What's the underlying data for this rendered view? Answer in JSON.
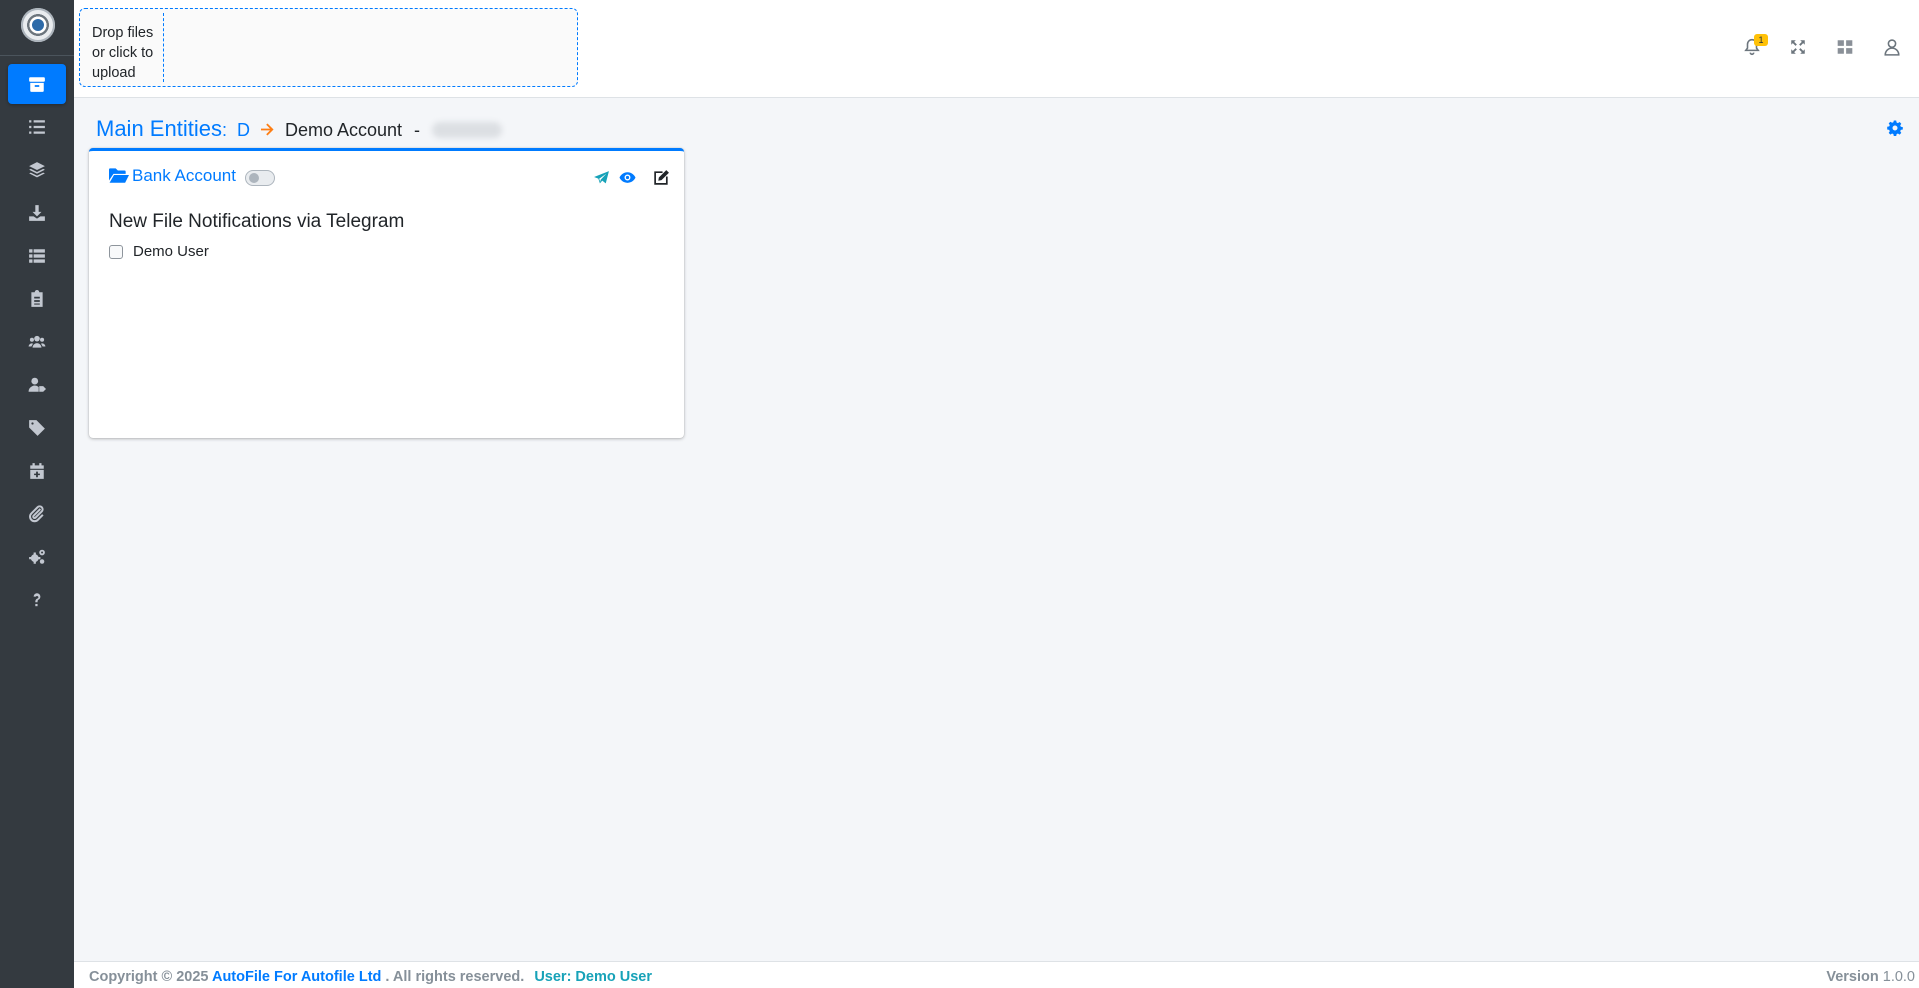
{
  "upload": {
    "dropzone_text": "Drop files or click to upload"
  },
  "topbar": {
    "notification_count": "1"
  },
  "breadcrumb": {
    "main": "Main Entities",
    "colon": ":",
    "level1": "D",
    "level2": "Demo Account",
    "separator": "-"
  },
  "card": {
    "title": "Bank Account",
    "toggle_on": false,
    "section_title": "New File Notifications via Telegram",
    "users": [
      {
        "label": "Demo User",
        "checked": false
      }
    ]
  },
  "footer": {
    "copyright": "Copyright © 2025",
    "company": "AutoFile For Autofile Ltd",
    "rights": ". All rights reserved.",
    "user": "User: Demo User",
    "version_label": "Version",
    "version_value": "1.0.0"
  },
  "colors": {
    "accent": "#007bff",
    "sidebar_bg": "#343a40",
    "badge": "#ffc107",
    "telegram": "#17a2b8",
    "arrow": "#fd7e14"
  },
  "sidebar": {
    "items": [
      {
        "icon": "archive-icon",
        "active": true
      },
      {
        "icon": "list-icon"
      },
      {
        "icon": "layers-icon"
      },
      {
        "icon": "download-icon"
      },
      {
        "icon": "table-list-icon"
      },
      {
        "icon": "clipboard-icon"
      },
      {
        "icon": "users-icon"
      },
      {
        "icon": "user-tag-icon"
      },
      {
        "icon": "tag-icon"
      },
      {
        "icon": "calendar-plus-icon"
      },
      {
        "icon": "paperclip-icon"
      },
      {
        "icon": "cogs-icon"
      },
      {
        "icon": "question-icon"
      }
    ]
  }
}
